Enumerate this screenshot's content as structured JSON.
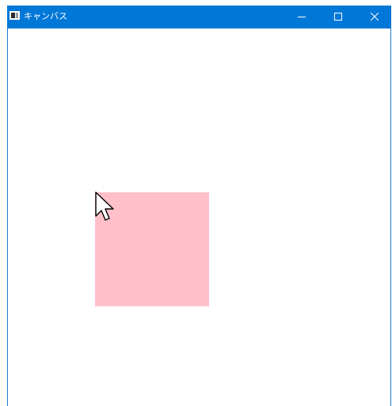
{
  "window": {
    "title": "キャンバス",
    "icon": "window-app-icon",
    "controls": {
      "minimize": "minimize-icon",
      "maximize": "maximize-icon",
      "close": "close-icon"
    }
  },
  "canvas": {
    "shape": {
      "type": "square",
      "fill_color": "#ffc0cb"
    },
    "cursor_icon": "arrow-cursor-icon"
  },
  "colors": {
    "titlebar": "#0078d7",
    "window_border": "#1c7ad6",
    "background": "#ffffff"
  }
}
